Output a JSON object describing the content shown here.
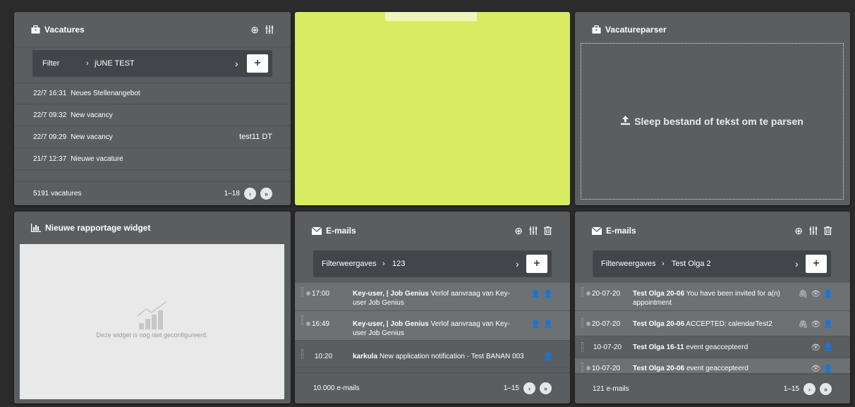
{
  "vacatures": {
    "title": "Vacatures",
    "filter_label": "Filter",
    "filter_value": "jUNE TEST",
    "rows": [
      {
        "time": "22/7 16:31",
        "title": "Neues Stellenangebot",
        "tag": ""
      },
      {
        "time": "22/7 09:32",
        "title": "New vacancy",
        "tag": ""
      },
      {
        "time": "22/7 09:29",
        "title": "New vacancy",
        "tag": "test11 DT"
      },
      {
        "time": "21/7 12:37",
        "title": "Nieuwe vacature",
        "tag": ""
      }
    ],
    "count": "5191 vacatures",
    "range": "1–18"
  },
  "green_widget": {
    "color": "#d8ec63"
  },
  "parser": {
    "title": "Vacatureparser",
    "dropzone_text": "Sleep bestand of tekst om te parsen"
  },
  "report": {
    "title": "Nieuwe rapportage widget",
    "empty_text": "Deze widget is nog niet geconfigureerd."
  },
  "emails1": {
    "title": "E-mails",
    "filter_label": "Filterweergaves",
    "filter_value": "123",
    "rows": [
      {
        "time": "17:00",
        "sender": "Key-user, | Job Genius",
        "subject": "Verlof aanvraag van Key-user Job Genius"
      },
      {
        "time": "16:49",
        "sender": "Key-user, | Job Genius",
        "subject": "Verlof aanvraag van Key-user Job Genius"
      },
      {
        "time": "10:20",
        "sender": "karkula",
        "subject": "New application notification - Test BANAN 003"
      }
    ],
    "count": "10.000 e-mails",
    "range": "1–15"
  },
  "emails2": {
    "title": "E-mails",
    "filter_label": "Filterweergaves",
    "filter_value": "Test Olga 2",
    "rows": [
      {
        "time": "20-07-20",
        "sender": "Test Olga 20-06",
        "subject": "You have been invited for a(n) appointment"
      },
      {
        "time": "20-07-20",
        "sender": "Test Olga 20-06",
        "subject": "ACCEPTED: calendarTest2"
      },
      {
        "time": "10-07-20",
        "sender": "Test Olga 16-11",
        "subject": "event geaccepteerd"
      },
      {
        "time": "10-07-20",
        "sender": "Test Olga 20-06",
        "subject": "event geaccepteerd"
      }
    ],
    "count": "121 e-mails",
    "range": "1–15"
  }
}
